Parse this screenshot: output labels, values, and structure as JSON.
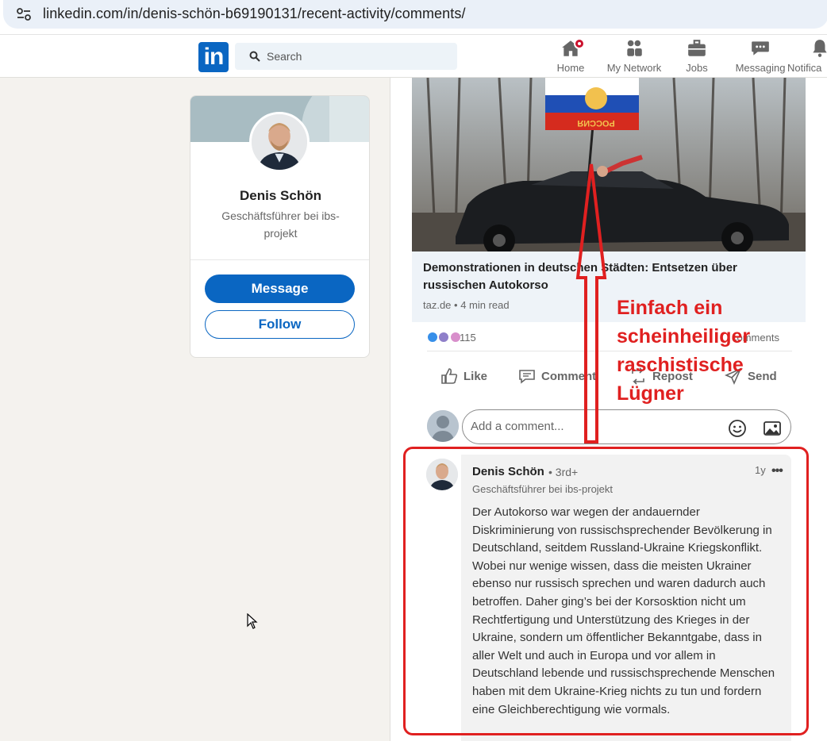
{
  "browser": {
    "url": "linkedin.com/in/denis-schön-b69190131/recent-activity/comments/"
  },
  "nav": {
    "search_placeholder": "Search",
    "items": [
      {
        "label": "Home"
      },
      {
        "label": "My Network"
      },
      {
        "label": "Jobs"
      },
      {
        "label": "Messaging"
      },
      {
        "label": "Notifica"
      }
    ]
  },
  "profile": {
    "name": "Denis Schön",
    "headline": "Geschäftsführer bei ibs-projekt",
    "message_label": "Message",
    "follow_label": "Follow"
  },
  "post": {
    "article_title": "Demonstrationen in deutschen Städten: Entsetzen über russischen Autokorso",
    "article_meta": "taz.de • 4 min read",
    "flag_text": "РОССИЯ",
    "reaction_count": "115",
    "comment_count": "comments",
    "actions": {
      "like": "Like",
      "comment": "Comment",
      "repost": "Repost",
      "send": "Send"
    },
    "comment_placeholder": "Add a comment..."
  },
  "comment": {
    "author": "Denis Schön",
    "degree": "• 3rd+",
    "time": "1y",
    "more": "•••",
    "headline": "Geschäftsführer bei ibs-projekt",
    "text": "Der Autokorso war wegen der andauernder Diskriminierung von russischsprechender Bevölkerung in Deutschland, seitdem Russland-Ukraine Kriegskonflikt. Wobei nur wenige wissen, dass die meisten Ukrainer ebenso nur russisch sprechen und waren dadurch auch betroffen. Daher ging’s bei der Korsosktion nicht um Rechtfertigung und Unterstützung des Krieges in der Ukraine, sondern um öffentlicher Bekanntgabe, dass in aller Welt und auch in Europa und vor allem in Deutschland lebende und russischsprechende Menschen haben mit dem Ukraine-Krieg nichts zu tun und fordern eine Gleichberechtigung wie vormals."
  },
  "annotation": {
    "text": "Einfach ein\nscheinheiliger\nraschistische\nLügner",
    "color": "#e02020"
  },
  "colors": {
    "brand": "#0a66c2",
    "notification": "#cb112d"
  }
}
